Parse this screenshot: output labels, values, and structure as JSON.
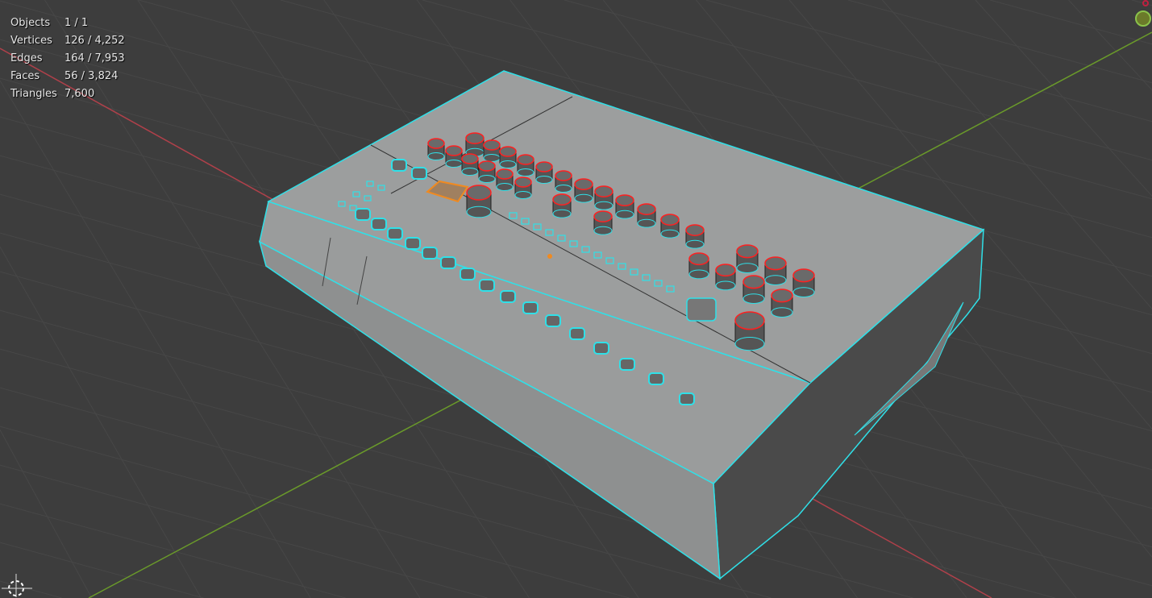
{
  "viewport": {
    "background": "#3d3d3d",
    "grid_color": "#4a4a4a",
    "x_axis_color": "#b0404a",
    "y_axis_color": "#6a9a2a",
    "selection_color": "#2fe0e8",
    "active_color": "#f08a20",
    "knob_edge_color": "#ff2020",
    "gizmo_y_color": "#8bc34a"
  },
  "stats": [
    {
      "label": "Objects",
      "value": "1 / 1"
    },
    {
      "label": "Vertices",
      "value": "126 / 4,252"
    },
    {
      "label": "Edges",
      "value": "164 / 7,953"
    },
    {
      "label": "Faces",
      "value": "56 / 3,824"
    },
    {
      "label": "Triangles",
      "value": "7,600"
    }
  ]
}
